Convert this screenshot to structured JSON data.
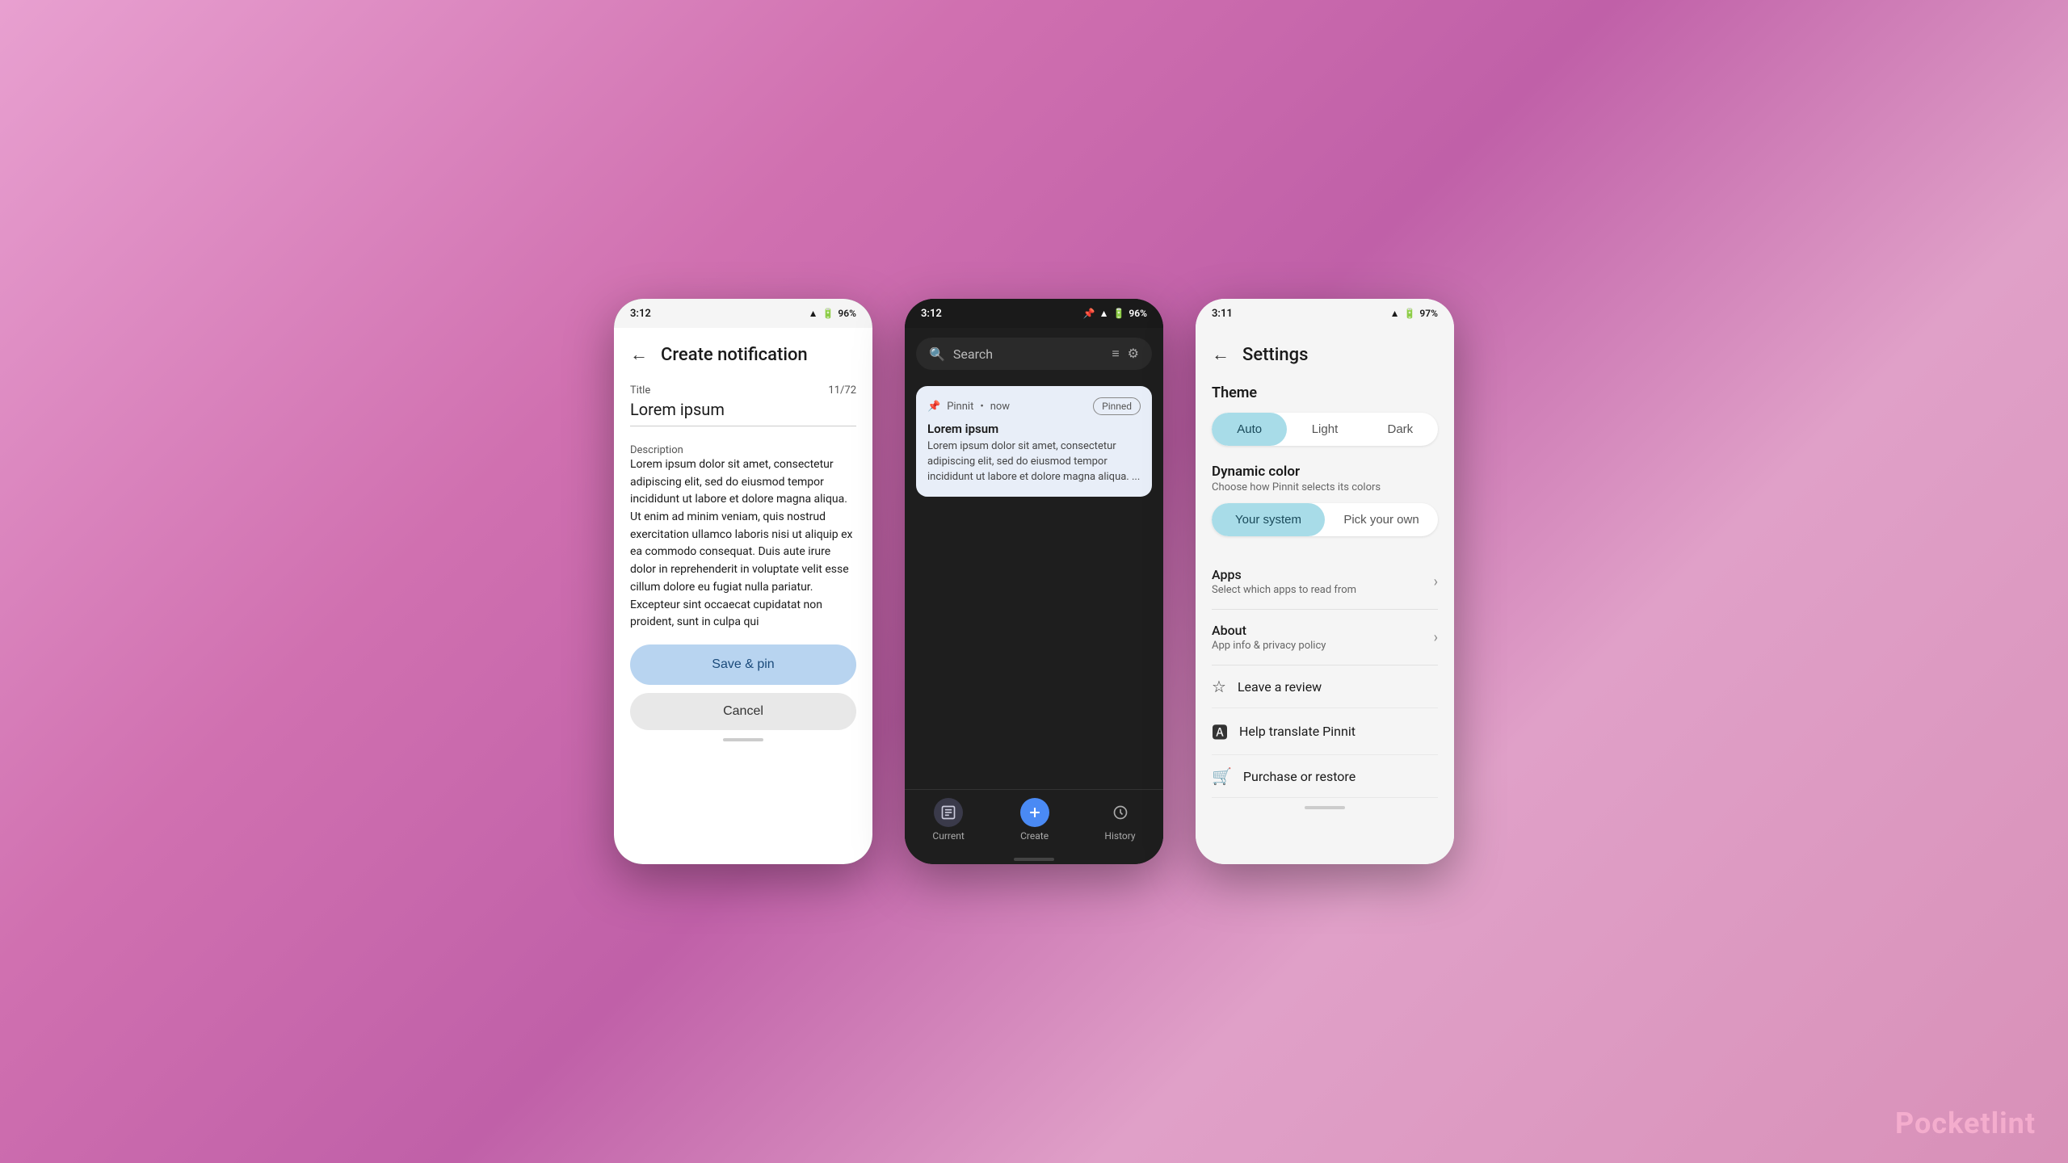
{
  "watermark": {
    "text1": "Pocket",
    "text2": "lint"
  },
  "phone1": {
    "status_time": "3:12",
    "status_battery": "96%",
    "header": {
      "back_label": "←",
      "title": "Create notification"
    },
    "title_field": {
      "label": "Title",
      "counter": "11/72",
      "value": "Lorem ipsum"
    },
    "description_field": {
      "label": "Description",
      "value": "Lorem ipsum dolor sit amet, consectetur adipiscing elit, sed do eiusmod tempor incididunt ut labore et dolore magna aliqua. Ut enim ad minim veniam, quis nostrud exercitation ullamco laboris nisi ut aliquip ex ea commodo consequat. Duis aute irure dolor in reprehenderit in voluptate velit esse cillum dolore eu fugiat nulla pariatur. Excepteur sint occaecat cupidatat non proident, sunt in culpa qui"
    },
    "save_btn": "Save & pin",
    "cancel_btn": "Cancel"
  },
  "phone2": {
    "status_time": "3:12",
    "status_battery": "96%",
    "search": {
      "placeholder": "Search"
    },
    "notification": {
      "app": "Pinnit",
      "time": "now",
      "badge": "Pinned",
      "title": "Lorem ipsum",
      "body": "Lorem ipsum dolor sit amet, consectetur adipiscing elit, sed do eiusmod tempor incididunt ut labore et dolore magna aliqua. ..."
    },
    "nav": {
      "current": "Current",
      "create": "Create",
      "history": "History"
    }
  },
  "phone3": {
    "status_time": "3:11",
    "status_battery": "97%",
    "header": {
      "back_label": "←",
      "title": "Settings"
    },
    "theme": {
      "section_title": "Theme",
      "auto": "Auto",
      "light": "Light",
      "dark": "Dark"
    },
    "dynamic_color": {
      "title": "Dynamic color",
      "subtitle": "Choose how Pinnit selects its colors",
      "your_system": "Your system",
      "pick_your_own": "Pick your own"
    },
    "apps": {
      "title": "Apps",
      "subtitle": "Select which apps to read from"
    },
    "about": {
      "title": "About",
      "subtitle": "App info & privacy policy"
    },
    "leave_review": "Leave a review",
    "help_translate": "Help translate Pinnit",
    "purchase": "Purchase or restore"
  }
}
